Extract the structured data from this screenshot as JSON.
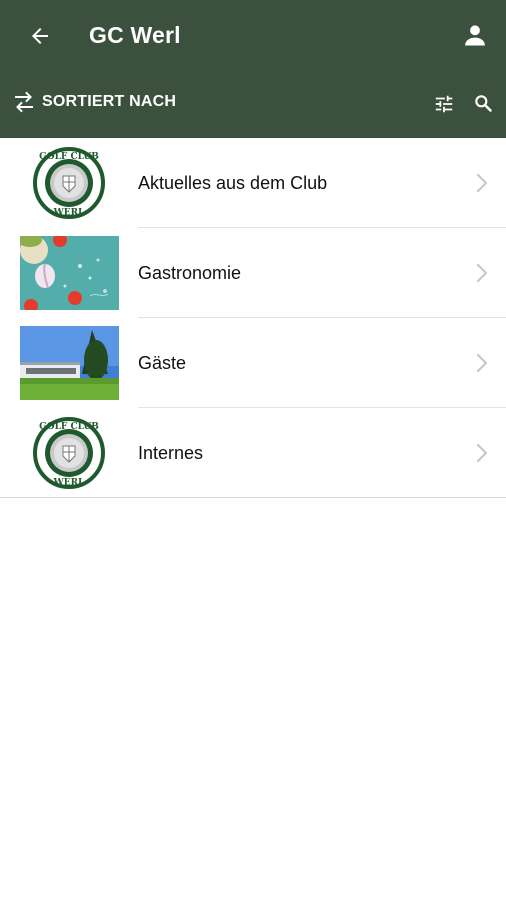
{
  "header": {
    "title": "GC Werl",
    "sort_label": "SORTIERT NACH"
  },
  "icons": {
    "back": "arrow-back-icon",
    "account": "account-icon",
    "sort": "swap-arrows-icon",
    "filter": "tune-icon",
    "search": "search-icon"
  },
  "colors": {
    "appbar": "#3b503d",
    "logo_green": "#1f5a2e"
  },
  "list": {
    "items": [
      {
        "label": "Aktuelles aus dem Club",
        "thumb": "golf-club-werl-logo"
      },
      {
        "label": "Gastronomie",
        "thumb": "food-photo"
      },
      {
        "label": "Gäste",
        "thumb": "clubhouse-photo"
      },
      {
        "label": "Internes",
        "thumb": "golf-club-werl-logo"
      }
    ],
    "logo_text": {
      "top": "GOLF CLUB",
      "bottom": "WERL"
    }
  }
}
